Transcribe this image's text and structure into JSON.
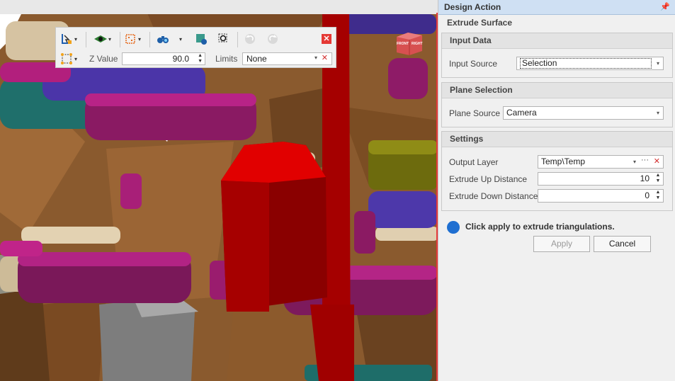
{
  "toolbar": {
    "z_value_label": "Z Value",
    "z_value": "90.0",
    "limits_label": "Limits",
    "limits_value": "None",
    "icons": [
      "select-tool-icon",
      "view-eye-icon",
      "snap-grid-icon",
      "binoculars-icon",
      "layer-filter-icon",
      "selection-box-icon",
      "undo-icon",
      "redo-icon",
      "close-icon",
      "point-snap-icon"
    ]
  },
  "viewcube": {
    "front": "FRONT",
    "right": "RIGHT"
  },
  "panel": {
    "title": "Design Action",
    "subtitle": "Extrude Surface",
    "input_data": {
      "header": "Input Data",
      "input_source_label": "Input Source",
      "input_source_value": "Selection"
    },
    "plane_selection": {
      "header": "Plane Selection",
      "plane_source_label": "Plane Source",
      "plane_source_value": "Camera"
    },
    "settings": {
      "header": "Settings",
      "output_layer_label": "Output Layer",
      "output_layer_value": "Temp\\Temp",
      "extrude_up_label": "Extrude Up Distance",
      "extrude_up_value": "10",
      "extrude_down_label": "Extrude Down Distance",
      "extrude_down_value": "0"
    },
    "info_message": "Click apply to extrude triangulations.",
    "apply_label": "Apply",
    "cancel_label": "Cancel"
  },
  "colors": {
    "accent_blue": "#1f6fd1",
    "header_blue": "#cfe0f3",
    "extrusion_red": "#e00000",
    "close_red": "#e53935"
  }
}
